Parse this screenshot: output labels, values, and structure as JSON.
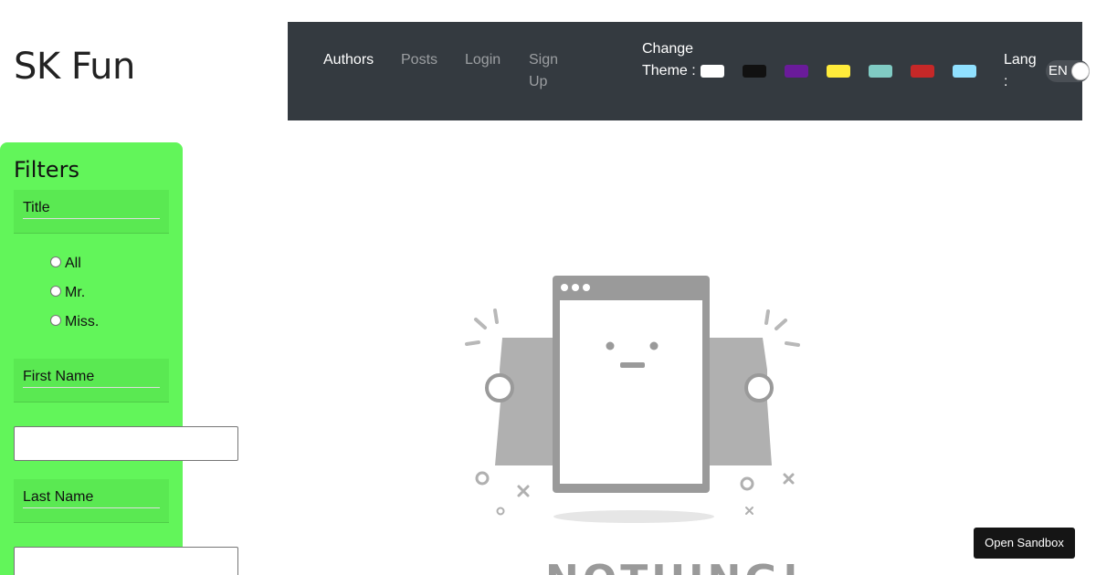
{
  "app": {
    "brand": "SK Fun"
  },
  "nav": {
    "links": [
      {
        "label": "Authors",
        "active": true
      },
      {
        "label": "Posts",
        "active": false
      },
      {
        "label": "Login",
        "active": false
      },
      {
        "label": "Sign Up",
        "active": false
      }
    ],
    "theme_label": "Change Theme :",
    "theme_colors": [
      "#ffffff",
      "#111111",
      "#6a1b9a",
      "#ffeb3b",
      "#80cbc4",
      "#c62828",
      "#90e0ff"
    ],
    "lang_label": "Lang :",
    "lang_value": "EN"
  },
  "filters": {
    "title": "Filters",
    "title_field": "Title",
    "title_options": [
      "All",
      "Mr.",
      "Miss."
    ],
    "first_name_label": "First Name",
    "first_name_value": "",
    "last_name_label": "Last Name",
    "last_name_value": ""
  },
  "empty_state": {
    "icon": "empty-window-illustration",
    "text": "NOTHING!"
  },
  "sandbox_button": "Open Sandbox",
  "colors": {
    "navbar_bg": "#343a40",
    "filters_bg": "#62f55a",
    "illustration_gray": "#9e9e9e"
  }
}
